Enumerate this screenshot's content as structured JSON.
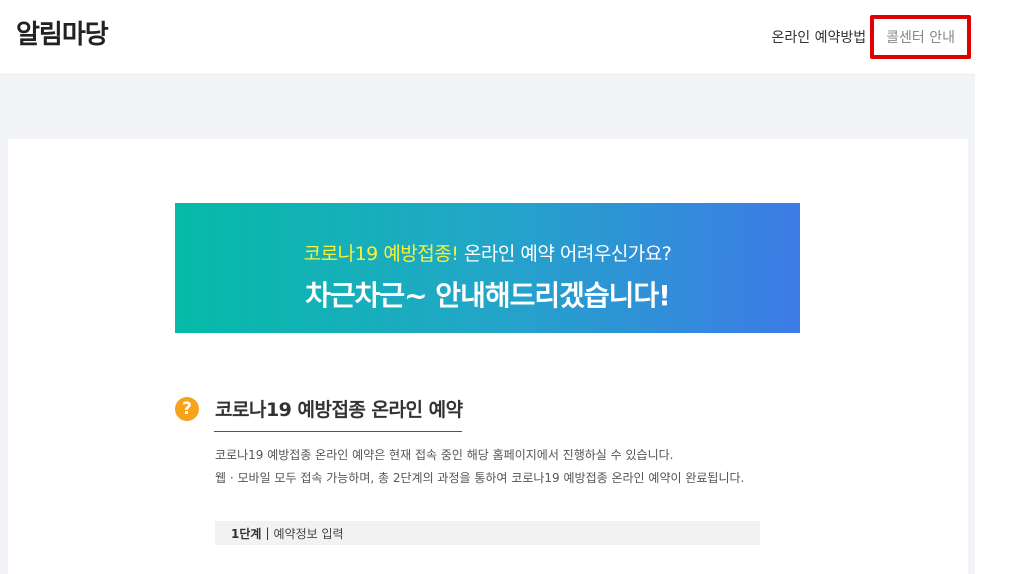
{
  "header": {
    "logo": "알림마당",
    "nav": [
      {
        "label": "온라인 예약방법"
      },
      {
        "label": "콜센터 안내"
      }
    ]
  },
  "banner": {
    "highlight": "코로나19 예방접종!",
    "line1_rest": " 온라인 예약 어려우신가요?",
    "line2": "차근차근~ 안내해드리겠습니다!"
  },
  "section": {
    "icon": "question-icon",
    "icon_glyph": "?",
    "title": "코로나19 예방접종 온라인 예약",
    "desc": [
      "코로나19 예방접종 온라인 예약은 현재 접속 중인 해당 홈페이지에서 진행하실 수 있습니다.",
      "웹 · 모바일 모두 접속 가능하며, 총 2단계의 과정을 통하여 코로나19 예방접종 온라인 예약이 완료됩니다."
    ]
  },
  "step": {
    "number": "1단계",
    "separator": "|",
    "label": "예약정보 입력"
  },
  "colors": {
    "highlight_box": "#e00000",
    "banner_start": "#06bba7",
    "banner_end": "#3d7be6",
    "banner_highlight": "#f6f23a",
    "icon": "#f6a21c"
  }
}
